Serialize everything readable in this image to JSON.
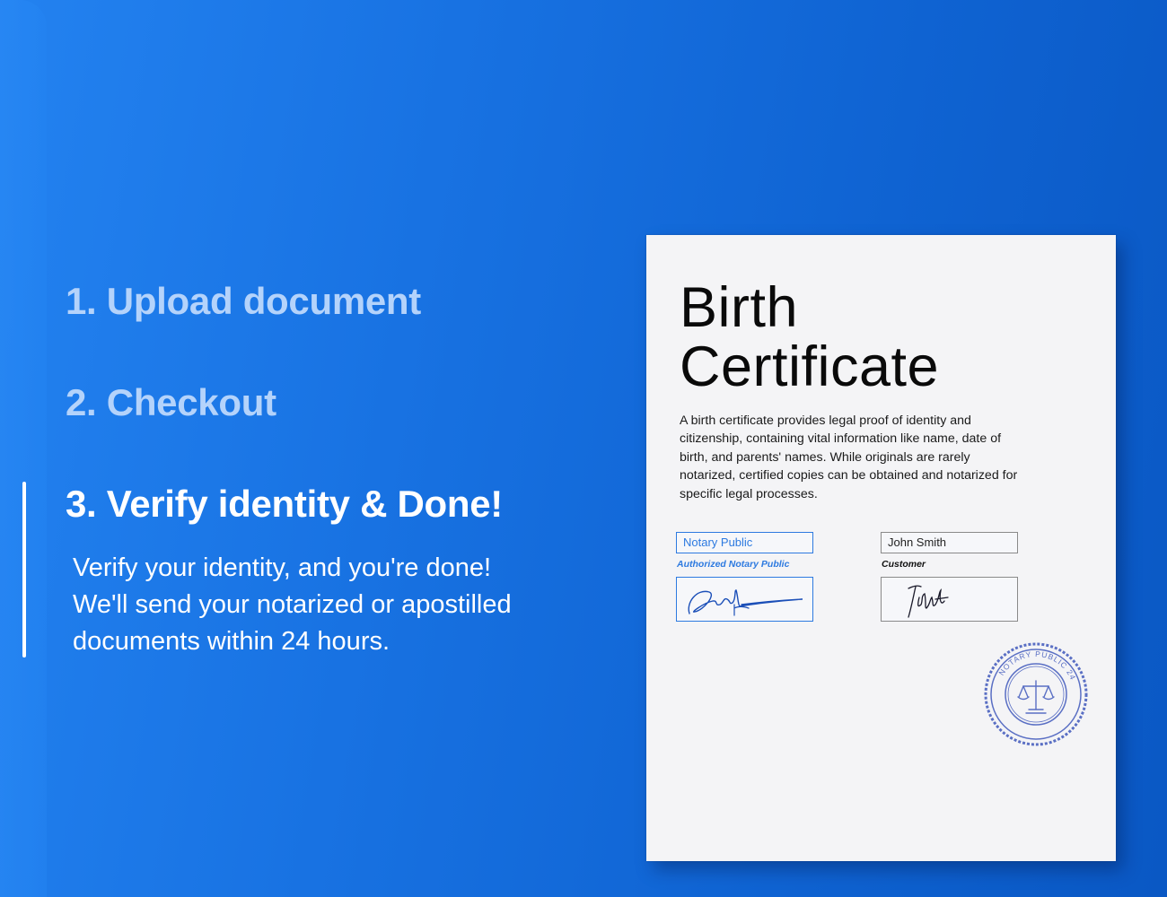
{
  "steps": [
    {
      "label": "1. Upload document",
      "active": false
    },
    {
      "label": "2. Checkout",
      "active": false
    },
    {
      "label": "3. Verify identity & Done!",
      "active": true
    }
  ],
  "active_step_description": "Verify your identity, and you're done!\nWe'll send your notarized or apostilled\ndocuments within 24 hours.",
  "certificate": {
    "title": "Birth\nCertificate",
    "body": "A birth certificate provides legal proof of identity and citizenship, containing vital information like name, date of birth, and parents' names. While originals are rarely notarized, certified copies can be obtained and notarized for specific legal processes.",
    "notary_field_value": "Notary Public",
    "notary_caption": "Authorized Notary Public",
    "customer_field_value": "John Smith",
    "customer_caption": "Customer",
    "seal_text": "NOTARY PUBLIC 24"
  },
  "colors": {
    "background_start": "#2382f0",
    "background_end": "#0a58c4",
    "inactive_step": "#b4d3fb",
    "active_step": "#ffffff",
    "notary_accent": "#2d7ae0",
    "seal": "#5a6fc4"
  }
}
